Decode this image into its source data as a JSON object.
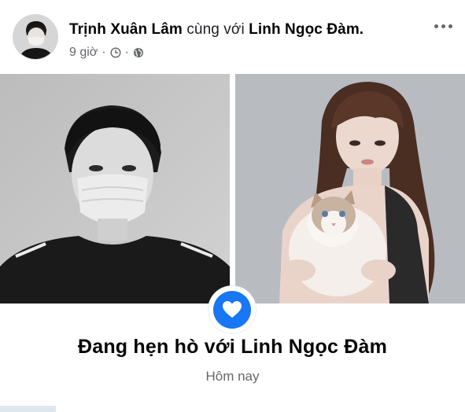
{
  "post": {
    "author": "Trịnh Xuân Lâm",
    "with_text": "cùng với",
    "tagged": "Linh Ngọc Đàm.",
    "time": "9 giờ",
    "separator": "·",
    "time_icon": "clock-icon",
    "privacy_icon": "globe-icon",
    "more_icon": "more-dots-icon"
  },
  "life_event": {
    "icon": "heart-icon",
    "title": "Đang hẹn hò với Linh Ngọc Đàm",
    "date": "Hôm nay"
  },
  "colors": {
    "accent": "#1877f2",
    "secondary_text": "#65676b",
    "primary_text": "#050505"
  }
}
